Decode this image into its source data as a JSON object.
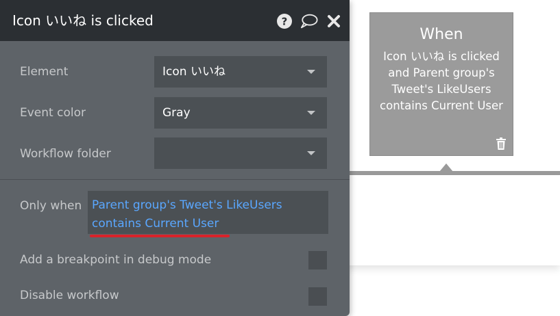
{
  "panel": {
    "title": "Icon いいね is clicked",
    "icons": [
      "help-icon",
      "comment-icon",
      "close-icon"
    ],
    "fields": {
      "element": {
        "label": "Element",
        "value": "Icon いいね"
      },
      "event_color": {
        "label": "Event color",
        "value": "Gray"
      },
      "workflow_folder": {
        "label": "Workflow folder",
        "value": ""
      }
    },
    "only_when": {
      "label": "Only when",
      "expression": "Parent group's Tweet's LikeUsers contains Current User"
    },
    "breakpoint": {
      "label": "Add a breakpoint in debug mode",
      "checked": false
    },
    "disable": {
      "label": "Disable workflow",
      "checked": false
    }
  },
  "card": {
    "title": "When",
    "description": "Icon いいね is clicked\nand Parent group's\nTweet's LikeUsers\ncontains Current User"
  },
  "colors": {
    "header": "#2b2f33",
    "panel": "#5e6368",
    "input": "#4b5054",
    "expression_link": "#5aa7ff",
    "underline_annotation": "#d9222a",
    "card": "#9b9b9b"
  }
}
